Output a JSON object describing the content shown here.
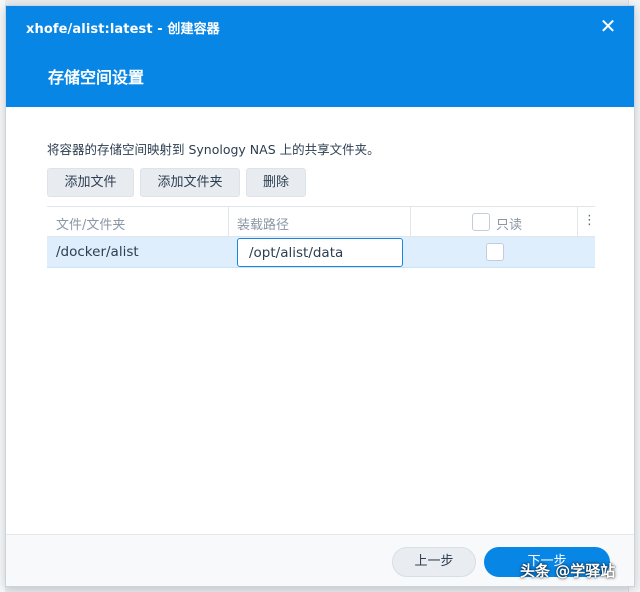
{
  "window": {
    "title": "xhofe/alist:latest - 创建容器",
    "close_label": "✕"
  },
  "step": {
    "title": "存储空间设置"
  },
  "description": "将容器的存储空间映射到 Synology NAS 上的共享文件夹。",
  "toolbar": {
    "add_file": "添加文件",
    "add_folder": "添加文件夹",
    "delete": "删除"
  },
  "table": {
    "columns": {
      "file_folder": "文件/文件夹",
      "mount_path": "装载路径",
      "read_only": "只读",
      "more_icon": "⋮"
    },
    "rows": [
      {
        "file_folder": "/docker/alist",
        "mount_path": "/opt/alist/data",
        "read_only": false
      }
    ]
  },
  "footer": {
    "prev": "上一步",
    "next": "下一步"
  },
  "watermark": "头条 @学驿站",
  "colors": {
    "accent": "#0886e5",
    "row_selected": "#deeefc"
  }
}
